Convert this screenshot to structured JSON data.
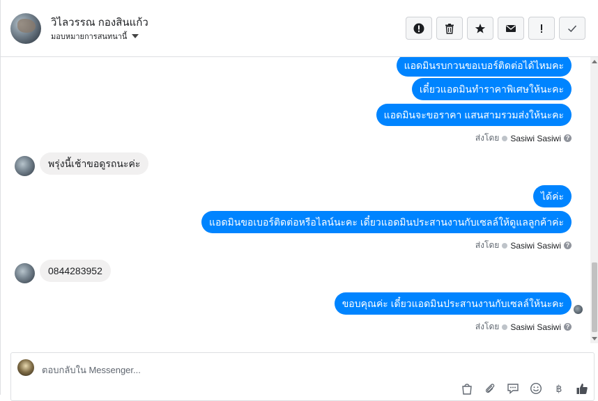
{
  "header": {
    "name": "วิไลวรรณ กองสินแก้ว",
    "assign_label": "มอบหมายการสนทนานี้",
    "toolbar": [
      {
        "icon": "alert-circle-icon",
        "name": "report-button"
      },
      {
        "icon": "trash-icon",
        "name": "delete-button"
      },
      {
        "icon": "star-icon",
        "name": "star-button"
      },
      {
        "icon": "envelope-icon",
        "name": "mark-unread-button"
      },
      {
        "icon": "exclamation-icon",
        "name": "spam-button"
      },
      {
        "icon": "check-icon",
        "name": "mark-done-button"
      }
    ]
  },
  "messages": {
    "out1": "แอดมินรบกวนขอเบอร์ติดต่อได้ไหมคะ",
    "out2": "เดี๋ยวแอดมินทำราคาพิเศษให้นะคะ",
    "out3": "แอดมินจะขอราคา แสนสามรวมส่งให้นะคะ",
    "sent_by_prefix": "ส่งโดย",
    "sent_by_name": "Sasiwi Sasiwi",
    "in1": "พรุ่งนี้เช้าขอดูรถนะค่ะ",
    "out4": "ได้ค่ะ",
    "out5": "แอดมินขอเบอร์ติดต่อหรือไลน์นะคะ เดี๋ยวแอดมินประสานงานกับเซลล์ให้ดูแลลูกค้าค่ะ",
    "in2": "0844283952",
    "out6": "ขอบคุณค่ะ เดี๋ยวแอดมินประสานงานกับเซลล์ให้นะคะ"
  },
  "composer": {
    "placeholder": "ตอบกลับใน Messenger...",
    "icons": [
      "shopping-bag-icon",
      "paperclip-icon",
      "chat-bubble-icon",
      "smiley-icon",
      "baht-icon",
      "thumbs-up-icon"
    ]
  },
  "colors": {
    "accent": "#0084ff",
    "incoming_bubble": "#f1f0f0"
  }
}
